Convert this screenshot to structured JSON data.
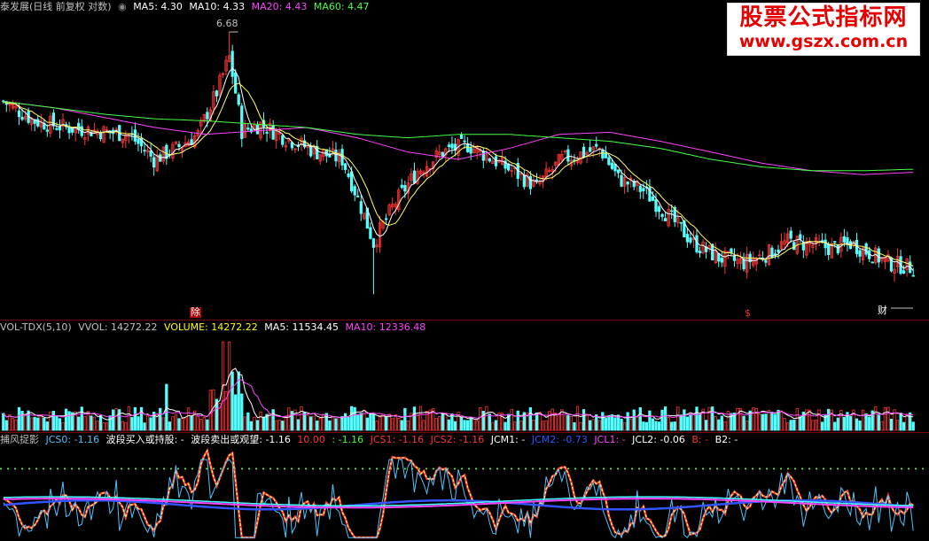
{
  "header": {
    "title": "泰发展(日线 前复权 对数)",
    "ma_labels": [
      {
        "label": "MA5: 4.30",
        "color": "#ffffff"
      },
      {
        "label": "MA10: 4.33",
        "color": "#ffffff"
      },
      {
        "label": "MA20: 4.43",
        "color": "#ff44ff"
      },
      {
        "label": "MA60: 4.47",
        "color": "#44ff44"
      }
    ]
  },
  "price_pane": {
    "peak_label": "6.68",
    "low_label": "",
    "markers": [
      "除",
      "$",
      "财"
    ],
    "ylim": [
      3.0,
      7.0
    ]
  },
  "volume_pane": {
    "labels": [
      {
        "label": "VOL-TDX(5,10)",
        "color": "#c0c0c0"
      },
      {
        "label": "VVOL: 14272.22",
        "color": "#c0c0c0"
      },
      {
        "label": "VOLUME: 14272.22",
        "color": "#ffff00"
      },
      {
        "label": "MA5: 11534.45",
        "color": "#ffffff"
      },
      {
        "label": "MA10: 12336.48",
        "color": "#ff44ff"
      }
    ]
  },
  "indicator_pane": {
    "labels": [
      {
        "label": "捕风捉影",
        "color": "#c0c0c0"
      },
      {
        "label": "JCS0: -1.16",
        "color": "#4fc3ff"
      },
      {
        "label": "波段买入或持股: -",
        "color": "#ffffff"
      },
      {
        "label": "波段卖出或观望: -1.16",
        "color": "#ffffff"
      },
      {
        "label": "10.00",
        "color": "#ff3333"
      },
      {
        "label": ": -1.16",
        "color": "#44ff44"
      },
      {
        "label": "JCS1: -1.16",
        "color": "#ff3333"
      },
      {
        "label": "JCS2: -1.16",
        "color": "#ff3333"
      },
      {
        "label": "JCM1: -",
        "color": "#ffffff"
      },
      {
        "label": "JCM2: -0.73",
        "color": "#3355ff"
      },
      {
        "label": "JCL1: -",
        "color": "#ff44ff"
      },
      {
        "label": "JCL2: -0.06",
        "color": "#ffffff"
      },
      {
        "label": "B: -",
        "color": "#ff3333"
      },
      {
        "label": "B2: -",
        "color": "#ffffff"
      }
    ]
  },
  "watermark": {
    "title": "股票公式指标网",
    "url": "www.gszx.com.cn"
  },
  "colors": {
    "up": "#ff3333",
    "down": "#54ffff",
    "ma5": "#ffffff",
    "ma10": "#ffff66",
    "ma20": "#ff44ff",
    "ma60": "#44ff44"
  },
  "chart_data": {
    "type": "line",
    "title": "泰发展(日线 前复权 对数)",
    "xlabel": "",
    "ylabel": "",
    "ylim": [
      3.0,
      7.0
    ],
    "grid": false,
    "series": [
      {
        "name": "MA20",
        "values": [
          5.45,
          5.35,
          5.2,
          5.05,
          4.95,
          5.0,
          5.05,
          4.9,
          4.7,
          4.6,
          4.75,
          4.95,
          4.98,
          4.85,
          4.7,
          4.55,
          4.45,
          4.4,
          4.43
        ]
      },
      {
        "name": "MA60",
        "values": [
          5.45,
          5.35,
          5.25,
          5.18,
          5.15,
          5.1,
          5.05,
          4.95,
          4.9,
          4.95,
          4.95,
          4.9,
          4.85,
          4.75,
          4.6,
          4.5,
          4.45,
          4.45,
          4.47
        ]
      }
    ]
  }
}
